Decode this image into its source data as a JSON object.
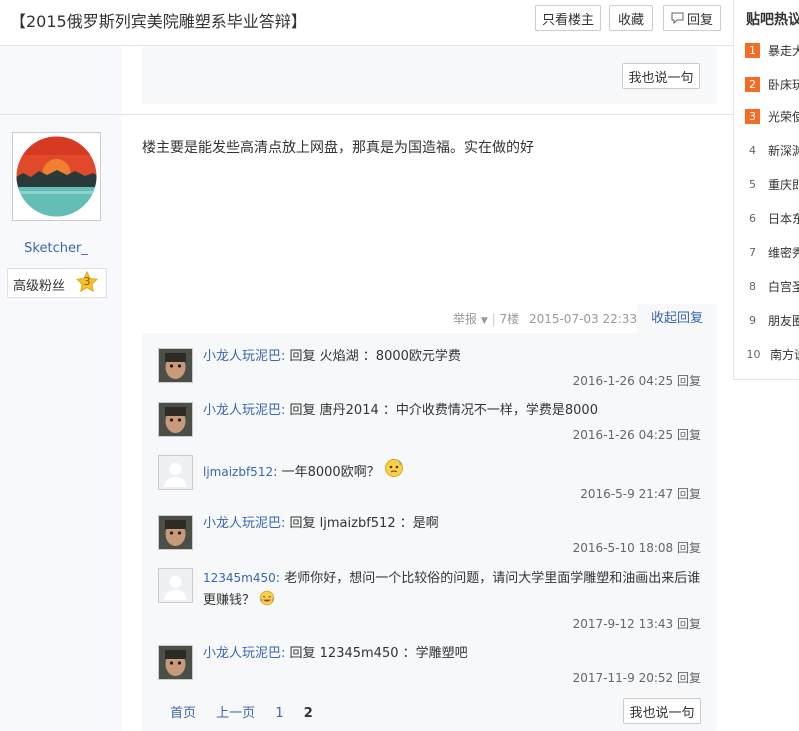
{
  "thread": {
    "title": "【2015俄罗斯列宾美院雕塑系毕业答辩】",
    "buttons": {
      "only_op": "只看楼主",
      "favorite": "收藏",
      "reply": "回复"
    }
  },
  "prev_post": {
    "say_button": "我也说一句"
  },
  "post": {
    "username": "Sketcher_",
    "rank": "高级粉丝",
    "level": "3",
    "content": "楼主要是能发些高清点放上网盘，那真是为国造福。实在做的好",
    "meta": {
      "report": "举报",
      "floor": "7楼",
      "time": "2015-07-03 22:33"
    },
    "collapse": "收起回复"
  },
  "replies": [
    {
      "user": "小龙人玩泥巴",
      "text": "回复 火焰湖 ：8000欧元学费",
      "time": "2016-1-26 04:25",
      "action": "回复",
      "avatar": "child"
    },
    {
      "user": "小龙人玩泥巴",
      "text": "回复 唐丹2014 ：中介收费情况不一样，学费是8000",
      "time": "2016-1-26 04:25",
      "action": "回复",
      "avatar": "child"
    },
    {
      "user": "ljmaizbf512",
      "text": "一年8000欧啊？",
      "time": "2016-5-9 21:47",
      "action": "回复",
      "avatar": "default"
    },
    {
      "user": "小龙人玩泥巴",
      "text": "回复 ljmaizbf512 ：是啊",
      "time": "2016-5-10 18:08",
      "action": "回复",
      "avatar": "child"
    },
    {
      "user": "12345m450",
      "text": "老师你好，想问一个比较俗的问题，请问大学里面学雕塑和油画出来后谁更赚钱？",
      "time": "2017-9-12 13:43",
      "action": "回复",
      "avatar": "default"
    },
    {
      "user": "小龙人玩泥巴",
      "text": "回复 12345m450 ：学雕塑吧",
      "time": "2017-11-9 20:52",
      "action": "回复",
      "avatar": "child"
    }
  ],
  "pager": {
    "first": "首页",
    "prev": "上一页",
    "page1": "1",
    "page2": "2",
    "say_button": "我也说一句"
  },
  "hot": {
    "title": "贴吧热议",
    "items": [
      {
        "rank": "1",
        "text": "暴走大"
      },
      {
        "rank": "2",
        "text": "卧床玩"
      },
      {
        "rank": "3",
        "text": "光荣使"
      },
      {
        "rank": "4",
        "text": "新深渊"
      },
      {
        "rank": "5",
        "text": "重庆即"
      },
      {
        "rank": "6",
        "text": "日本东"
      },
      {
        "rank": "7",
        "text": "维密秀"
      },
      {
        "rank": "8",
        "text": "白宫圣"
      },
      {
        "rank": "9",
        "text": "朋友圈"
      },
      {
        "rank": "10",
        "text": "南方说"
      }
    ]
  },
  "colors": {
    "link": "#3a66b0",
    "hot_rank": "#f56c28",
    "panel": "#f7f8fa"
  }
}
